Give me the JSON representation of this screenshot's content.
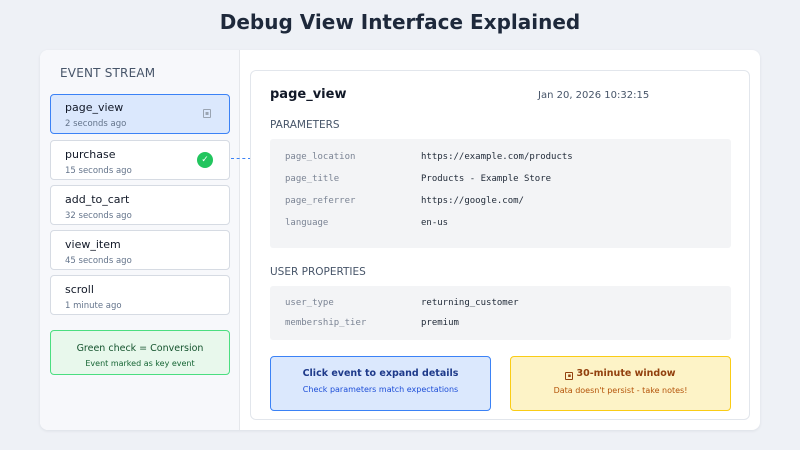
{
  "title": "Debug View Interface Explained",
  "sidebar": {
    "title": "EVENT STREAM",
    "events": [
      {
        "name": "page_view",
        "time": "2 seconds ago",
        "selected": true,
        "conversion": false
      },
      {
        "name": "purchase",
        "time": "15 seconds ago",
        "selected": false,
        "conversion": true
      },
      {
        "name": "add_to_cart",
        "time": "32 seconds ago",
        "selected": false,
        "conversion": false
      },
      {
        "name": "view_item",
        "time": "45 seconds ago",
        "selected": false,
        "conversion": false
      },
      {
        "name": "scroll",
        "time": "1 minute ago",
        "selected": false,
        "conversion": false
      }
    ],
    "legend": {
      "title": "Green check = Conversion",
      "subtitle": "Event marked as key event"
    }
  },
  "detail": {
    "event_name": "page_view",
    "timestamp": "Jan 20, 2026 10:32:15",
    "parameters_label": "PARAMETERS",
    "parameters": [
      {
        "key": "page_location",
        "value": "https://example.com/products"
      },
      {
        "key": "page_title",
        "value": "Products - Example Store"
      },
      {
        "key": "page_referrer",
        "value": "https://google.com/"
      },
      {
        "key": "language",
        "value": "en-us"
      }
    ],
    "user_properties_label": "USER PROPERTIES",
    "user_properties": [
      {
        "key": "user_type",
        "value": "returning_customer"
      },
      {
        "key": "membership_tier",
        "value": "premium"
      }
    ]
  },
  "callouts": {
    "expand": {
      "title": "Click event to expand details",
      "subtitle": "Check parameters match expectations"
    },
    "window": {
      "title": "30-minute window",
      "subtitle": "Data doesn't persist - take notes!"
    }
  },
  "icons": {
    "check": "check-icon",
    "debug": "debug-icon",
    "clock": "clock-icon"
  },
  "colors": {
    "accent": "#3b82f6",
    "conversion": "#22c55e",
    "warning": "#facc15"
  }
}
